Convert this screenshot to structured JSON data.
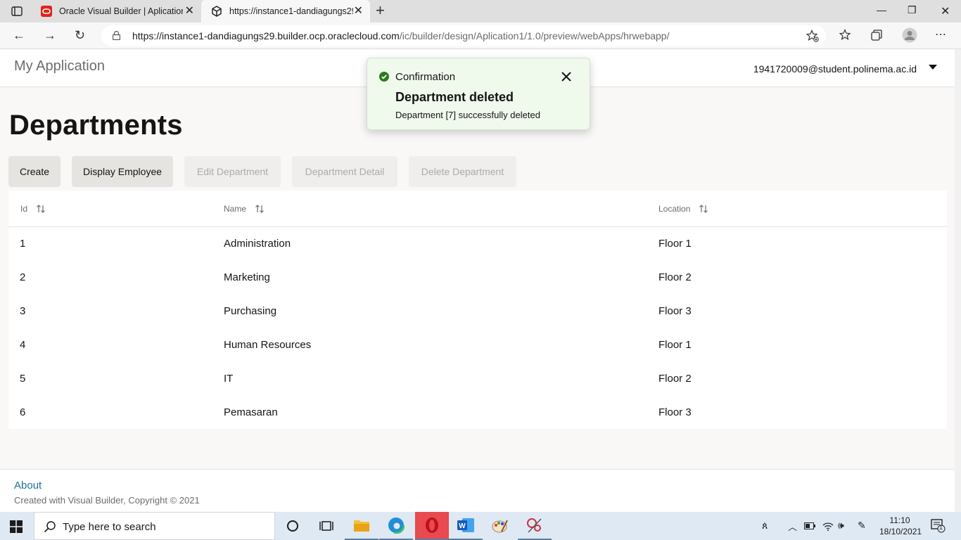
{
  "browser": {
    "tabs": [
      {
        "title": "Oracle Visual Builder | Aplication",
        "icon": "oracle-icon"
      },
      {
        "title": "https://instance1-dandiagungs29",
        "icon": "cube-icon"
      }
    ],
    "url_host": "https://instance1-dandiagungs29.builder.ocp.oraclecloud.com",
    "url_path": "/ic/builder/design/Aplication1/1.0/preview/webApps/hrwebapp/"
  },
  "app": {
    "name": "My Application",
    "user": "1941720009@student.polinema.ac.id"
  },
  "page": {
    "title": "Departments",
    "buttons": {
      "create": "Create",
      "display_employee": "Display Employee",
      "edit": "Edit Department",
      "detail": "Department Detail",
      "delete": "Delete Department"
    }
  },
  "table": {
    "columns": {
      "id": "Id",
      "name": "Name",
      "location": "Location"
    },
    "rows": [
      {
        "id": "1",
        "name": "Administration",
        "location": "Floor 1"
      },
      {
        "id": "2",
        "name": "Marketing",
        "location": "Floor 2"
      },
      {
        "id": "3",
        "name": "Purchasing",
        "location": "Floor 3"
      },
      {
        "id": "4",
        "name": "Human Resources",
        "location": "Floor 1"
      },
      {
        "id": "5",
        "name": "IT",
        "location": "Floor 2"
      },
      {
        "id": "6",
        "name": "Pemasaran",
        "location": "Floor 3"
      }
    ]
  },
  "toast": {
    "type": "Confirmation",
    "summary": "Department deleted",
    "detail": "Department [7] successfully deleted"
  },
  "footer": {
    "about": "About",
    "copyright": "Created with Visual Builder, Copyright © 2021"
  },
  "taskbar": {
    "search_placeholder": "Type here to search",
    "time": "11:10",
    "date": "18/10/2021",
    "notifications": "1"
  },
  "colors": {
    "accent_link": "#227093",
    "success": "#2c7a1f",
    "toast_bg": "#eff9ec"
  }
}
